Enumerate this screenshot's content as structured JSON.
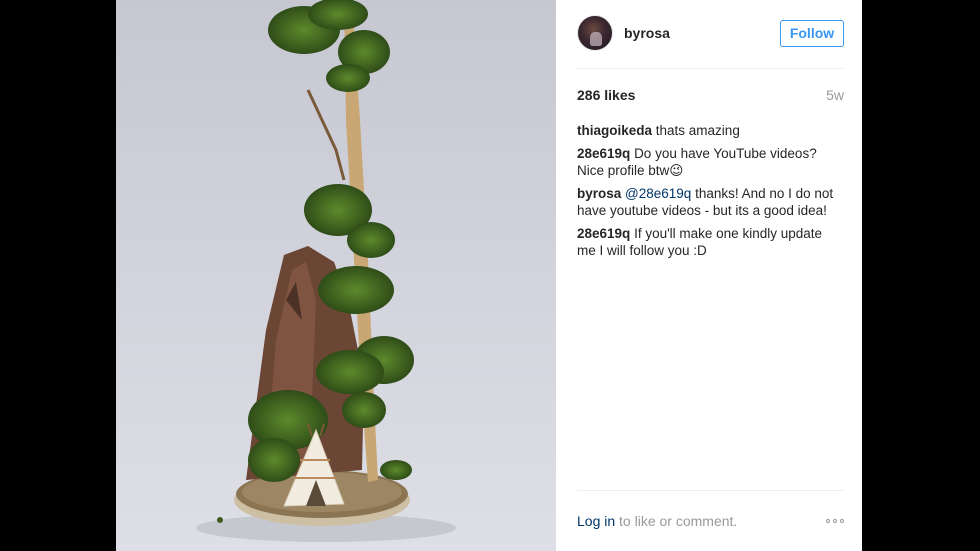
{
  "post": {
    "username": "byrosa",
    "follow_label": "Follow",
    "likes": "286 likes",
    "age": "5w"
  },
  "comments": [
    {
      "user": "thiagoikeda",
      "mention": "",
      "text": "thats amazing"
    },
    {
      "user": "28e619q",
      "mention": "",
      "text": "Do you have YouTube videos? Nice profile btw😉"
    },
    {
      "user": "byrosa",
      "mention": "@28e619q",
      "text": "thanks! And no I do not have youtube videos - but its a good idea!"
    },
    {
      "user": "28e619q",
      "mention": "",
      "text": "If you'll make one kindly update me I will follow you :D"
    }
  ],
  "footer": {
    "login_label": "Log in",
    "login_suffix": " to like or comment."
  },
  "icons": {
    "more": "more-options-icon",
    "avatar": "avatar"
  },
  "colors": {
    "accent": "#3897f0",
    "link": "#003569",
    "muted": "#999999",
    "text": "#262626"
  }
}
